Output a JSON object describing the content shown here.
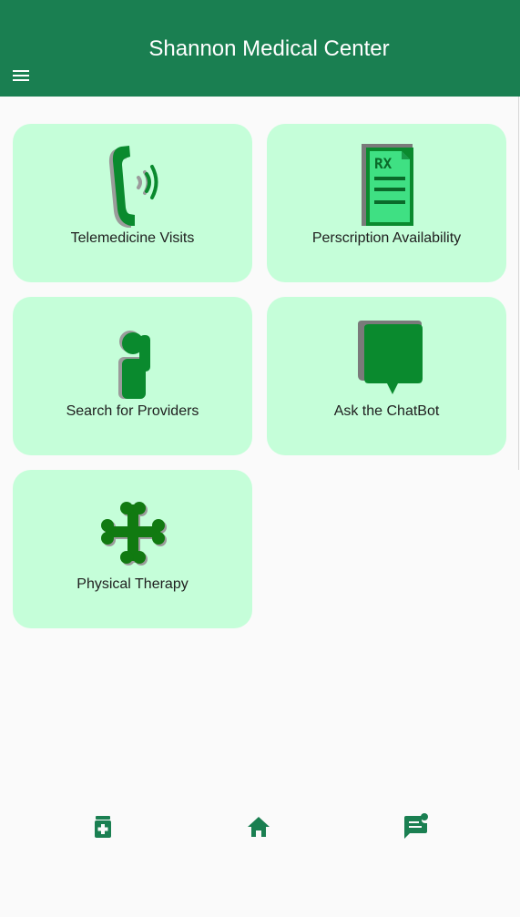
{
  "app": {
    "title": "Shannon Medical Center"
  },
  "header": {
    "menu_icon": "hamburger-menu-icon"
  },
  "cards": [
    {
      "label": "Telemedicine Visits",
      "icon": "phone-icon"
    },
    {
      "label": "Perscription Availability",
      "icon": "prescription-rx-icon"
    },
    {
      "label": "Search for Providers",
      "icon": "provider-person-icon"
    },
    {
      "label": "Ask the ChatBot",
      "icon": "chat-bubble-icon"
    },
    {
      "label": "Physical Therapy",
      "icon": "bone-cross-icon"
    }
  ],
  "bottom_nav": [
    {
      "icon": "medication-icon"
    },
    {
      "icon": "home-icon"
    },
    {
      "icon": "chat-notification-icon"
    }
  ],
  "colors": {
    "primary": "#1a7f51",
    "card_background": "#c5fed9",
    "icon_green": "#0a8a2e",
    "icon_shadow": "#9b9b9b",
    "page_background": "#fafafa"
  }
}
